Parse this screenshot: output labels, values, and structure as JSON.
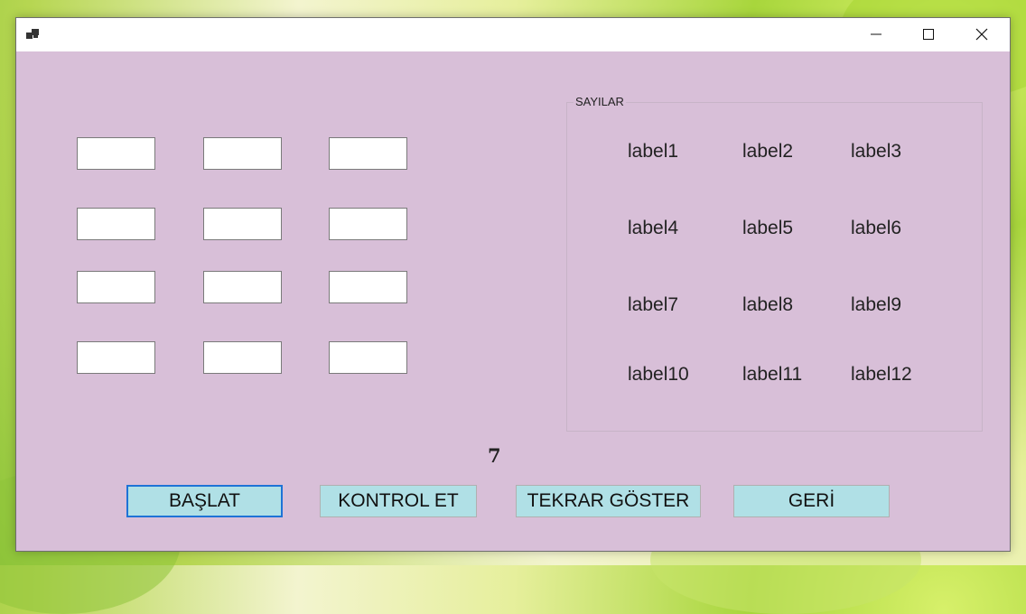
{
  "window": {
    "title": ""
  },
  "titlebar": {
    "minimize_icon": "minimize-icon",
    "maximize_icon": "maximize-icon",
    "close_icon": "close-icon"
  },
  "inputs": [
    {
      "value": ""
    },
    {
      "value": ""
    },
    {
      "value": ""
    },
    {
      "value": ""
    },
    {
      "value": ""
    },
    {
      "value": ""
    },
    {
      "value": ""
    },
    {
      "value": ""
    },
    {
      "value": ""
    },
    {
      "value": ""
    },
    {
      "value": ""
    },
    {
      "value": ""
    }
  ],
  "numbers_group": {
    "title": "SAYILAR",
    "labels": [
      "label1",
      "label2",
      "label3",
      "label4",
      "label5",
      "label6",
      "label7",
      "label8",
      "label9",
      "label10",
      "label11",
      "label12"
    ]
  },
  "counter": "7",
  "buttons": {
    "start": "BAŞLAT",
    "check": "KONTROL ET",
    "show_again": "TEKRAR GÖSTER",
    "back": "GERİ"
  },
  "colors": {
    "form_background": "#d8bfd8",
    "button_background": "#b0e0e6",
    "focus_border": "#1e73d6"
  }
}
